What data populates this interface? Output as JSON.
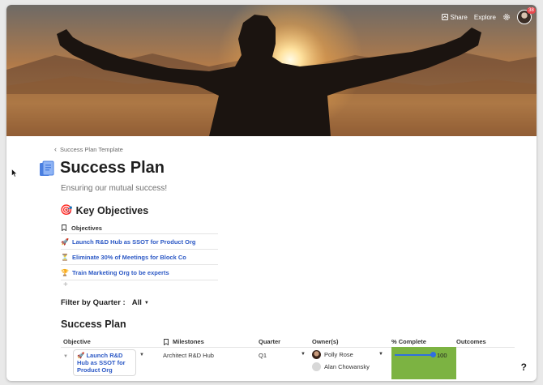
{
  "header": {
    "share_label": "Share",
    "explore_label": "Explore",
    "notification_count": "38"
  },
  "breadcrumb": {
    "label": "Success Plan Template"
  },
  "page": {
    "title": "Success Plan",
    "subtitle": "Ensuring our mutual success!"
  },
  "key_objectives": {
    "heading": "Key Objectives",
    "column_label": "Objectives",
    "items": [
      {
        "icon": "🚀",
        "label": "Launch R&D Hub as SSOT for Product Org"
      },
      {
        "icon": "⏳",
        "label": "Eliminate 30% of Meetings for Block Co"
      },
      {
        "icon": "🏆",
        "label": "Train Marketing Org to be experts"
      }
    ],
    "add_symbol": "+"
  },
  "filter": {
    "label": "Filter by Quarter :",
    "value": "All"
  },
  "success_plan": {
    "heading": "Success Plan",
    "columns": [
      "Objective",
      "Milestones",
      "Quarter",
      "Owner(s)",
      "% Complete",
      "Outcomes"
    ],
    "rows": [
      {
        "objective_icon": "🚀",
        "objective": "Launch R&D Hub as SSOT for Product Org",
        "milestone": "Architect R&D Hub",
        "quarter": "Q1",
        "owners": [
          "Polly Rose",
          "Alan Chowansky"
        ],
        "percent_complete": 100,
        "percent_label": "100",
        "outcome": ""
      }
    ]
  },
  "help_label": "?",
  "colors": {
    "link_blue": "#2b58c5",
    "complete_green": "#7cb342",
    "slider_blue": "#2f6fe0"
  }
}
